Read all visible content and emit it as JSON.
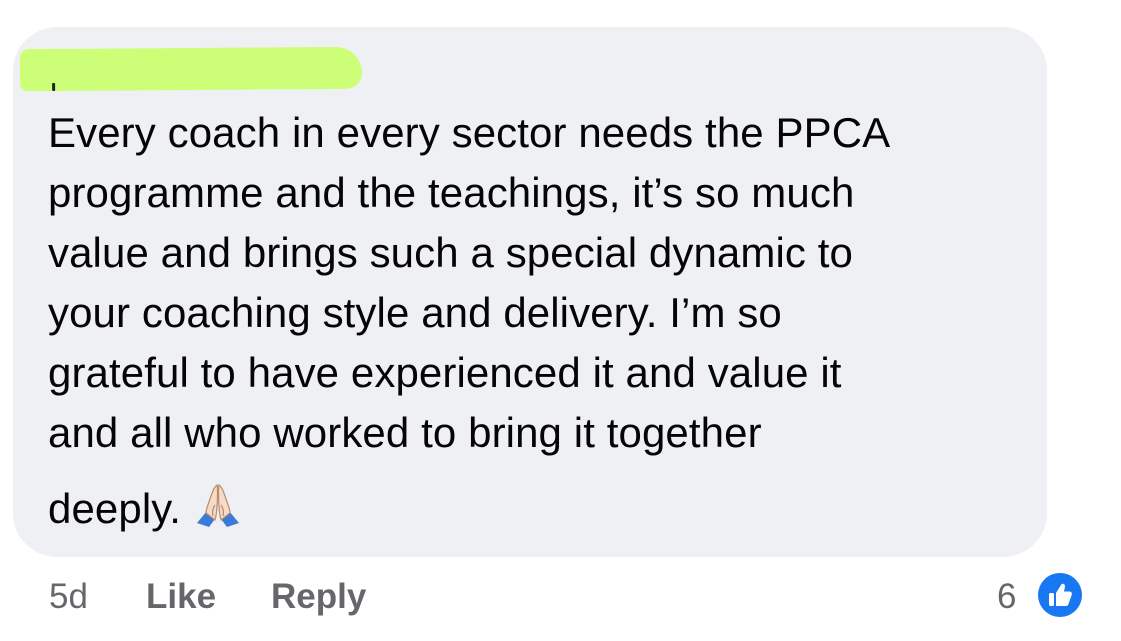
{
  "comment": {
    "text_lines": [
      "Every coach in every sector needs the PPCA",
      "programme and the teachings, it’s so much",
      "value and brings such a special dynamic to",
      "your coaching style and delivery. I’m so",
      "grateful to have experienced it and value it",
      "and all who worked to bring it together"
    ],
    "last_line": "deeply.",
    "emoji": "folded-hands-icon",
    "bubble_color": "#eff0f3",
    "redaction_color": "#ccff77"
  },
  "meta": {
    "timestamp": "5d",
    "like_label": "Like",
    "reply_label": "Reply",
    "reaction_count": "6",
    "reaction_icon": "like-thumb-icon",
    "accent_color": "#1877f2"
  }
}
